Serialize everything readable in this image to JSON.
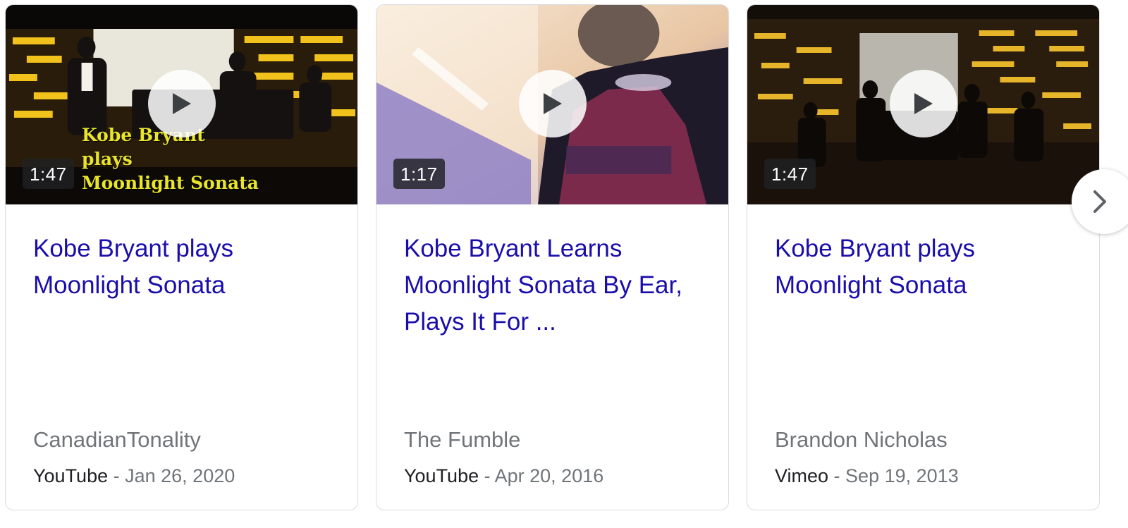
{
  "cards": [
    {
      "title": "Kobe Bryant plays Moonlight Sonata",
      "duration": "1:47",
      "channel": "CanadianTonality",
      "source": "YouTube",
      "separator": " - ",
      "date": "Jan 26, 2020",
      "thumbnail_overlay": [
        "Kobe Bryant",
        "plays",
        "Moonlight Sonata"
      ]
    },
    {
      "title": "Kobe Bryant Learns Moonlight Sonata By Ear, Plays It For ...",
      "duration": "1:17",
      "channel": "The Fumble",
      "source": "YouTube",
      "separator": " - ",
      "date": "Apr 20, 2016"
    },
    {
      "title": "Kobe Bryant plays Moonlight Sonata",
      "duration": "1:47",
      "channel": "Brandon Nicholas",
      "source": "Vimeo",
      "separator": " - ",
      "date": "Sep 19, 2013"
    }
  ],
  "icons": {
    "play": "play-icon",
    "next": "chevron-right-icon"
  },
  "colors": {
    "title_link": "#1a0dab",
    "secondary_text": "#70757a",
    "source_text": "#202124",
    "card_border": "#dadce0",
    "overlay_text": "#e8e52a"
  }
}
